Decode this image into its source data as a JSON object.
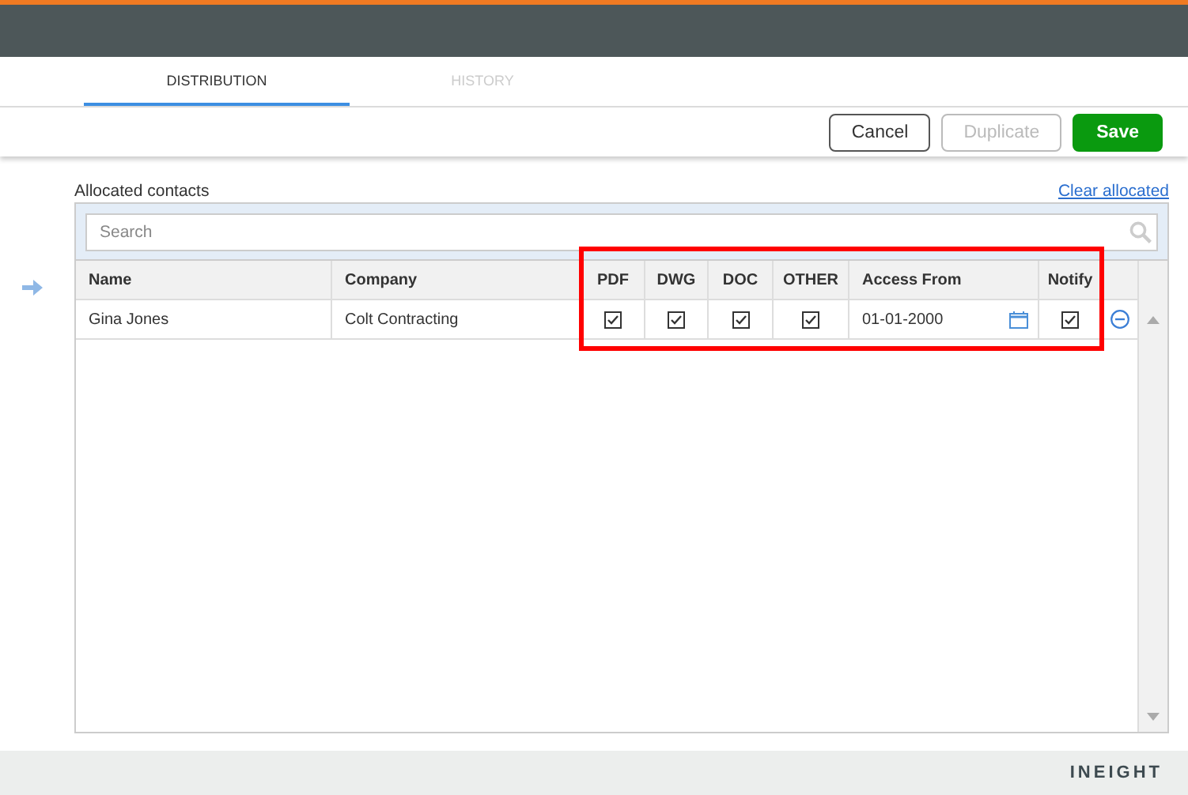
{
  "tabs": [
    {
      "label": "DISTRIBUTION",
      "selected": true
    },
    {
      "label": "HISTORY",
      "selected": false
    }
  ],
  "buttons": [
    {
      "label": "Cancel",
      "kind": "outline",
      "disabled": false
    },
    {
      "label": "Duplicate",
      "kind": "outline",
      "disabled": true
    },
    {
      "label": "Save",
      "kind": "primary",
      "disabled": false
    }
  ],
  "section_label": "Allocated contacts",
  "clear_link": "Clear allocated",
  "search": {
    "placeholder": "Search"
  },
  "table": {
    "columns": [
      "Name",
      "Company",
      "PDF",
      "DWG",
      "DOC",
      "OTHER",
      "Access From",
      "Notify"
    ],
    "rows": [
      {
        "name": "Gina Jones",
        "company": "Colt Contracting",
        "pdf": true,
        "dwg": true,
        "doc": true,
        "other": true,
        "access_from": "01-01-2000",
        "notify": true
      }
    ]
  },
  "footer": {
    "logo": "INEIGHT"
  }
}
